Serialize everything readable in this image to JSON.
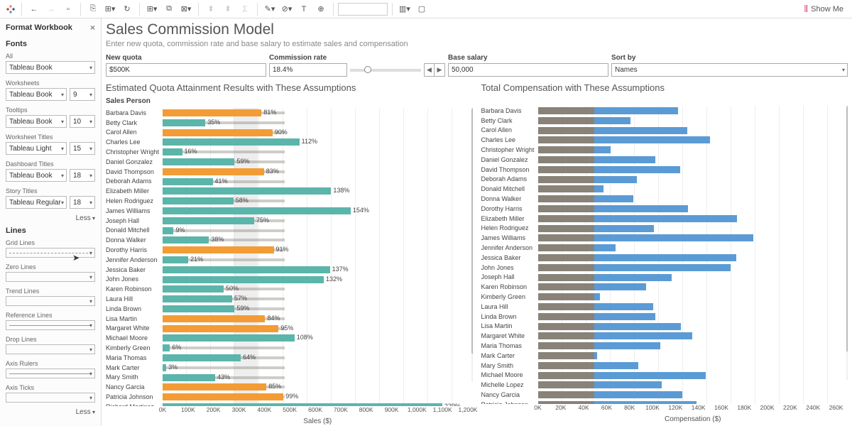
{
  "toolbar": {
    "show_me": "Show Me"
  },
  "sidebar": {
    "title": "Format Workbook",
    "fonts_section": "Fonts",
    "lines_section": "Lines",
    "labels": {
      "all": "All",
      "worksheets": "Worksheets",
      "tooltips": "Tooltips",
      "worksheet_titles": "Worksheet Titles",
      "dashboard_titles": "Dashboard Titles",
      "story_titles": "Story Titles",
      "grid_lines": "Grid Lines",
      "zero_lines": "Zero Lines",
      "trend_lines": "Trend Lines",
      "reference_lines": "Reference Lines",
      "drop_lines": "Drop Lines",
      "axis_rulers": "Axis Rulers",
      "axis_ticks": "Axis Ticks"
    },
    "values": {
      "all_font": "Tableau Book",
      "ws_font": "Tableau Book",
      "ws_size": "9",
      "tt_font": "Tableau Book",
      "tt_size": "10",
      "wt_font": "Tableau Light",
      "wt_size": "15",
      "dt_font": "Tableau Book",
      "dt_size": "18",
      "st_font": "Tableau Regular",
      "st_size": "18"
    },
    "less": "Less"
  },
  "dashboard": {
    "title": "Sales Commission Model",
    "subtitle": "Enter new quota, commission rate and base salary to estimate sales and compensation",
    "controls": {
      "new_quota": {
        "label": "New quota",
        "value": "$500K"
      },
      "commission": {
        "label": "Commission rate",
        "value": "18.4%"
      },
      "base_salary": {
        "label": "Base salary",
        "value": "50,000"
      },
      "sort_by": {
        "label": "Sort by",
        "value": "Names"
      }
    }
  },
  "chart_data": [
    {
      "type": "bar",
      "title": "Estimated Quota Attainment Results with These Assumptions",
      "subtitle": "Sales Person",
      "xlabel": "Sales ($)",
      "xlim": [
        0,
        1250000
      ],
      "ticks": [
        "0K",
        "100K",
        "200K",
        "300K",
        "400K",
        "500K",
        "600K",
        "700K",
        "800K",
        "900K",
        "1,000K",
        "1,100K",
        "1,200K"
      ],
      "reference_band": [
        290000,
        390000
      ],
      "rows": [
        {
          "name": "Barbara Davis",
          "pct": 81,
          "sales": 405000,
          "target": 500000,
          "color": "orange"
        },
        {
          "name": "Betty Clark",
          "pct": 35,
          "sales": 175000,
          "target": 500000,
          "color": "teal"
        },
        {
          "name": "Carol Allen",
          "pct": 90,
          "sales": 450000,
          "target": 500000,
          "color": "orange"
        },
        {
          "name": "Charles Lee",
          "pct": 112,
          "sales": 560000,
          "target": 500000,
          "color": "teal"
        },
        {
          "name": "Christopher Wright",
          "pct": 16,
          "sales": 80000,
          "target": 500000,
          "color": "teal"
        },
        {
          "name": "Daniel Gonzalez",
          "pct": 59,
          "sales": 295000,
          "target": 500000,
          "color": "teal"
        },
        {
          "name": "David Thompson",
          "pct": 83,
          "sales": 415000,
          "target": 500000,
          "color": "orange"
        },
        {
          "name": "Deborah Adams",
          "pct": 41,
          "sales": 205000,
          "target": 500000,
          "color": "teal"
        },
        {
          "name": "Elizabeth Miller",
          "pct": 138,
          "sales": 690000,
          "target": 500000,
          "color": "teal"
        },
        {
          "name": "Helen Rodriguez",
          "pct": 58,
          "sales": 290000,
          "target": 500000,
          "color": "teal"
        },
        {
          "name": "James Williams",
          "pct": 154,
          "sales": 770000,
          "target": 500000,
          "color": "teal"
        },
        {
          "name": "Joseph Hall",
          "pct": 75,
          "sales": 375000,
          "target": 500000,
          "color": "teal"
        },
        {
          "name": "Donald Mitchell",
          "pct": 9,
          "sales": 45000,
          "target": 500000,
          "color": "teal"
        },
        {
          "name": "Donna Walker",
          "pct": 38,
          "sales": 190000,
          "target": 500000,
          "color": "teal"
        },
        {
          "name": "Dorothy Harris",
          "pct": 91,
          "sales": 455000,
          "target": 500000,
          "color": "orange"
        },
        {
          "name": "Jennifer Anderson",
          "pct": 21,
          "sales": 105000,
          "target": 500000,
          "color": "teal"
        },
        {
          "name": "Jessica Baker",
          "pct": 137,
          "sales": 685000,
          "target": 500000,
          "color": "teal"
        },
        {
          "name": "John Jones",
          "pct": 132,
          "sales": 660000,
          "target": 500000,
          "color": "teal"
        },
        {
          "name": "Karen Robinson",
          "pct": 50,
          "sales": 250000,
          "target": 500000,
          "color": "teal"
        },
        {
          "name": "Laura Hill",
          "pct": 57,
          "sales": 285000,
          "target": 500000,
          "color": "teal"
        },
        {
          "name": "Linda Brown",
          "pct": 59,
          "sales": 295000,
          "target": 500000,
          "color": "teal"
        },
        {
          "name": "Lisa Martin",
          "pct": 84,
          "sales": 420000,
          "target": 500000,
          "color": "orange"
        },
        {
          "name": "Margaret White",
          "pct": 95,
          "sales": 475000,
          "target": 500000,
          "color": "orange"
        },
        {
          "name": "Michael Moore",
          "pct": 108,
          "sales": 540000,
          "target": 500000,
          "color": "teal"
        },
        {
          "name": "Kimberly Green",
          "pct": 6,
          "sales": 30000,
          "target": 500000,
          "color": "teal"
        },
        {
          "name": "Maria Thomas",
          "pct": 64,
          "sales": 320000,
          "target": 500000,
          "color": "teal"
        },
        {
          "name": "Mark Carter",
          "pct": 3,
          "sales": 15000,
          "target": 500000,
          "color": "teal"
        },
        {
          "name": "Mary Smith",
          "pct": 43,
          "sales": 215000,
          "target": 500000,
          "color": "teal"
        },
        {
          "name": "Nancy Garcia",
          "pct": 85,
          "sales": 425000,
          "target": 500000,
          "color": "orange"
        },
        {
          "name": "Patricia Johnson",
          "pct": 99,
          "sales": 495000,
          "target": 500000,
          "color": "orange"
        },
        {
          "name": "Richard Martinez",
          "pct": 229,
          "sales": 1145000,
          "target": 500000,
          "color": "teal"
        }
      ]
    },
    {
      "type": "bar",
      "title": "Total Compensation with These Assumptions",
      "xlabel": "Compensation ($)",
      "xlim": [
        0,
        265000
      ],
      "ticks": [
        "0K",
        "20K",
        "40K",
        "60K",
        "80K",
        "100K",
        "120K",
        "140K",
        "160K",
        "180K",
        "200K",
        "220K",
        "240K",
        "260K"
      ],
      "rows": [
        {
          "name": "Barbara Davis",
          "base": 50000,
          "total": 124520
        },
        {
          "name": "Betty Clark",
          "base": 50000,
          "total": 82200
        },
        {
          "name": "Carol Allen",
          "base": 50000,
          "total": 132800
        },
        {
          "name": "Charles Lee",
          "base": 50000,
          "total": 153040
        },
        {
          "name": "Christopher Wright",
          "base": 50000,
          "total": 64720
        },
        {
          "name": "Daniel Gonzalez",
          "base": 50000,
          "total": 104280
        },
        {
          "name": "David Thompson",
          "base": 50000,
          "total": 126360
        },
        {
          "name": "Deborah Adams",
          "base": 50000,
          "total": 87720
        },
        {
          "name": "Donald Mitchell",
          "base": 50000,
          "total": 58280
        },
        {
          "name": "Donna Walker",
          "base": 50000,
          "total": 84960
        },
        {
          "name": "Dorothy Harris",
          "base": 50000,
          "total": 133720
        },
        {
          "name": "Elizabeth Miller",
          "base": 50000,
          "total": 176960
        },
        {
          "name": "Helen Rodriguez",
          "base": 50000,
          "total": 103360
        },
        {
          "name": "James Williams",
          "base": 50000,
          "total": 191680
        },
        {
          "name": "Jennifer Anderson",
          "base": 50000,
          "total": 69320
        },
        {
          "name": "Jessica Baker",
          "base": 50000,
          "total": 176040
        },
        {
          "name": "John Jones",
          "base": 50000,
          "total": 171440
        },
        {
          "name": "Joseph Hall",
          "base": 50000,
          "total": 119000
        },
        {
          "name": "Karen Robinson",
          "base": 50000,
          "total": 96000
        },
        {
          "name": "Kimberly Green",
          "base": 50000,
          "total": 55520
        },
        {
          "name": "Laura Hill",
          "base": 50000,
          "total": 102440
        },
        {
          "name": "Linda Brown",
          "base": 50000,
          "total": 104280
        },
        {
          "name": "Lisa Martin",
          "base": 50000,
          "total": 127280
        },
        {
          "name": "Margaret White",
          "base": 50000,
          "total": 137400
        },
        {
          "name": "Maria Thomas",
          "base": 50000,
          "total": 108880
        },
        {
          "name": "Mark Carter",
          "base": 50000,
          "total": 52760
        },
        {
          "name": "Mary Smith",
          "base": 50000,
          "total": 89560
        },
        {
          "name": "Michael Moore",
          "base": 50000,
          "total": 149360
        },
        {
          "name": "Michelle Lopez",
          "base": 50000,
          "total": 110000
        },
        {
          "name": "Nancy Garcia",
          "base": 50000,
          "total": 128200
        },
        {
          "name": "Patricia Johnson",
          "base": 50000,
          "total": 141080
        }
      ]
    }
  ]
}
